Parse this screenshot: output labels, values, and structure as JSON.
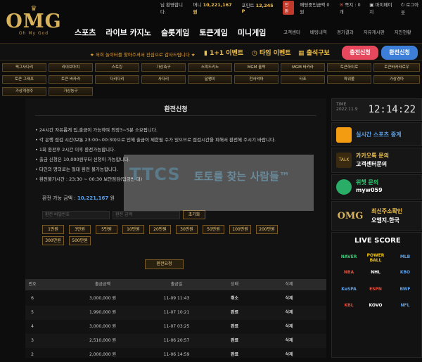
{
  "brand": {
    "name": "OMG",
    "tagline": "Oh My God"
  },
  "topbar": {
    "welcome": "님 환영합니다.",
    "money_label": "머니",
    "money": "10,221,167 원",
    "point_label": "포인트",
    "point": "12,245 P",
    "convert": "전환",
    "pending_label": "배팅중인금액",
    "pending": "0 원",
    "messages": "쪽지 : 0개",
    "mypage": "마이페이지",
    "logout": "로그아웃"
  },
  "main_nav": [
    "스포츠",
    "라이브 카지노",
    "슬롯게임",
    "토큰게임",
    "미니게임"
  ],
  "sub_nav": [
    "고객센터",
    "배팅내역",
    "경기결과",
    "자유게시판",
    "지인현황"
  ],
  "notice": "★ 저희 놀이터를 찾아주셔서 진심으로 감사드립니다 ★",
  "events": [
    "1+1 이벤트",
    "타임 이벤트",
    "출석구보"
  ],
  "charge_button": "충전신청",
  "withdraw_button": "환전신청",
  "games": [
    [
      "픽그사다리",
      "라이브마치",
      "스토킹",
      "가상축구",
      "스피드키노",
      "MGM 홀짝",
      "MGM 바카라",
      "토큰하이로",
      "토큰바카라로우"
    ],
    [
      "토큰 그래프",
      "토큰 바카라",
      "다리다리",
      "사다리",
      "달팽이",
      "천사악마",
      "타조",
      "파워볼",
      "가상경마"
    ],
    [
      "가상개경주",
      "가상농구"
    ]
  ],
  "time": {
    "label": "TIME",
    "date": "2022.11.9",
    "clock": "12:14:22"
  },
  "sidebar": {
    "sports_live": "실시간 스포츠 중계",
    "kakao_title": "카카오톡 문의",
    "kakao_sub": "고객센터문의",
    "wechat_title": "위챗 문의",
    "wechat_id": "myw059",
    "domain_title": "최신주소확인",
    "domain": "오엠지.한국",
    "live_score": "LIVE SCORE",
    "logos": [
      "NAVER",
      "POWER BALL",
      "MLB",
      "NBA",
      "NHL",
      "KBO",
      "KeSPA",
      "ESPN",
      "BWF",
      "KOVO",
      "KBL",
      "NFL"
    ]
  },
  "page": {
    "title": "환전신청",
    "rules": [
      "24시간 자유롭게 입,출금이 가능하며 최장3~5분 소요됩니다.",
      "각 은행 점검 시간(보통 23:00~00:30)으로 인해 출금이 제한될 수가 있으므로 점검시간을 피해서 환전해 주시기 바랍니다.",
      "1회 환전후 2시간 이후 환전가능합니다.",
      "출금 신청은 10,000원부터 신청이 가능합니다.",
      "타인의 명의로는 절대 환전 불가능합니다.",
      "환전불가시간 : 23:30 ~ 00:30 보안점검(입금반 대)"
    ],
    "amount_label": "환전 가능 금액 :",
    "amount": "10,221,167",
    "amount_unit": "원",
    "password_placeholder": "환전 비밀번호",
    "amount_placeholder": "환전 금액",
    "reset": "초기화",
    "amount_buttons": [
      "1만원",
      "3만원",
      "5만원",
      "10만원",
      "20만원",
      "30만원",
      "50만원",
      "100만원",
      "200만원",
      "300만원",
      "500만원"
    ],
    "submit": "환전요청"
  },
  "table": {
    "headers": [
      "번호",
      "출금금액",
      "출금일",
      "상태",
      "삭제"
    ],
    "rows": [
      [
        "6",
        "3,000,000 원",
        "11-09 11:43",
        "취소",
        "삭제"
      ],
      [
        "5",
        "1,990,000 원",
        "11-07 10:21",
        "완료",
        "삭제"
      ],
      [
        "4",
        "3,000,000 원",
        "11-07 03:25",
        "완료",
        "삭제"
      ],
      [
        "3",
        "2,510,000 원",
        "11-06 20:57",
        "완료",
        "삭제"
      ],
      [
        "2",
        "2,000,000 원",
        "11-06 14:59",
        "완료",
        "삭제"
      ]
    ]
  },
  "watermark": {
    "a": "TTCS",
    "b": "토토를 찾는 사람들™"
  }
}
